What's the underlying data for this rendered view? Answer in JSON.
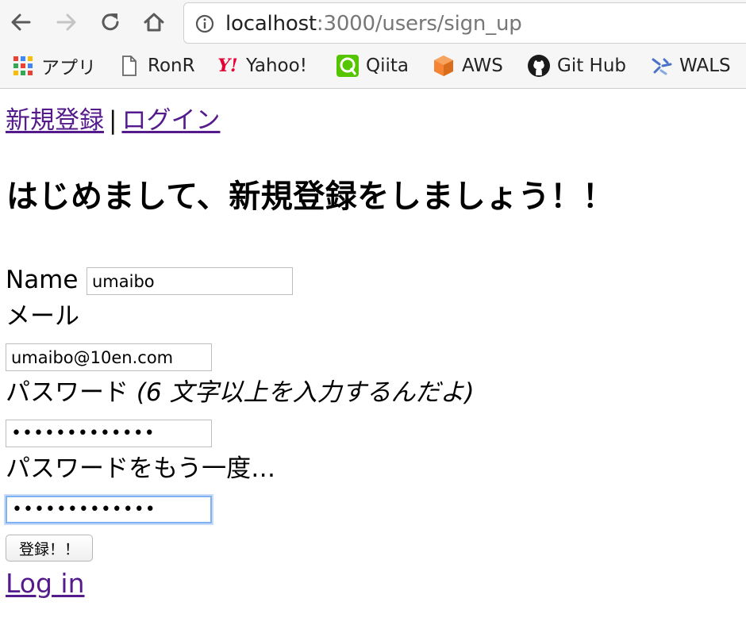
{
  "browser": {
    "url_host": "localhost",
    "url_path": ":3000/users/sign_up",
    "bookmarks": [
      {
        "label": "アプリ",
        "icon": "apps-grid-icon"
      },
      {
        "label": "RonR",
        "icon": "page-icon"
      },
      {
        "label": "Yahoo!",
        "icon": "yahoo-icon"
      },
      {
        "label": "Qiita",
        "icon": "qiita-icon"
      },
      {
        "label": "AWS",
        "icon": "aws-icon"
      },
      {
        "label": "Git Hub",
        "icon": "github-icon"
      },
      {
        "label": "WALS",
        "icon": "wals-icon"
      }
    ]
  },
  "nav": {
    "signup_label": "新規登録",
    "separator": "|",
    "login_label": "ログイン"
  },
  "heading": "はじめまして、新規登録をしましょう！！",
  "form": {
    "name_label": "Name",
    "name_value": "umaibo",
    "email_label": "メール",
    "email_value": "umaibo@10en.com",
    "password_label": "パスワード",
    "password_hint": "(6 文字以上を入力するんだよ)",
    "password_value": "•••••••••••••",
    "password_confirm_label": "パスワードをもう一度…",
    "password_confirm_value": "•••••••••••••",
    "submit_label": "登録！！"
  },
  "login_link": "Log in",
  "colors": {
    "visited_link": "#551a8b",
    "focus_ring": "#7fb0f2"
  }
}
